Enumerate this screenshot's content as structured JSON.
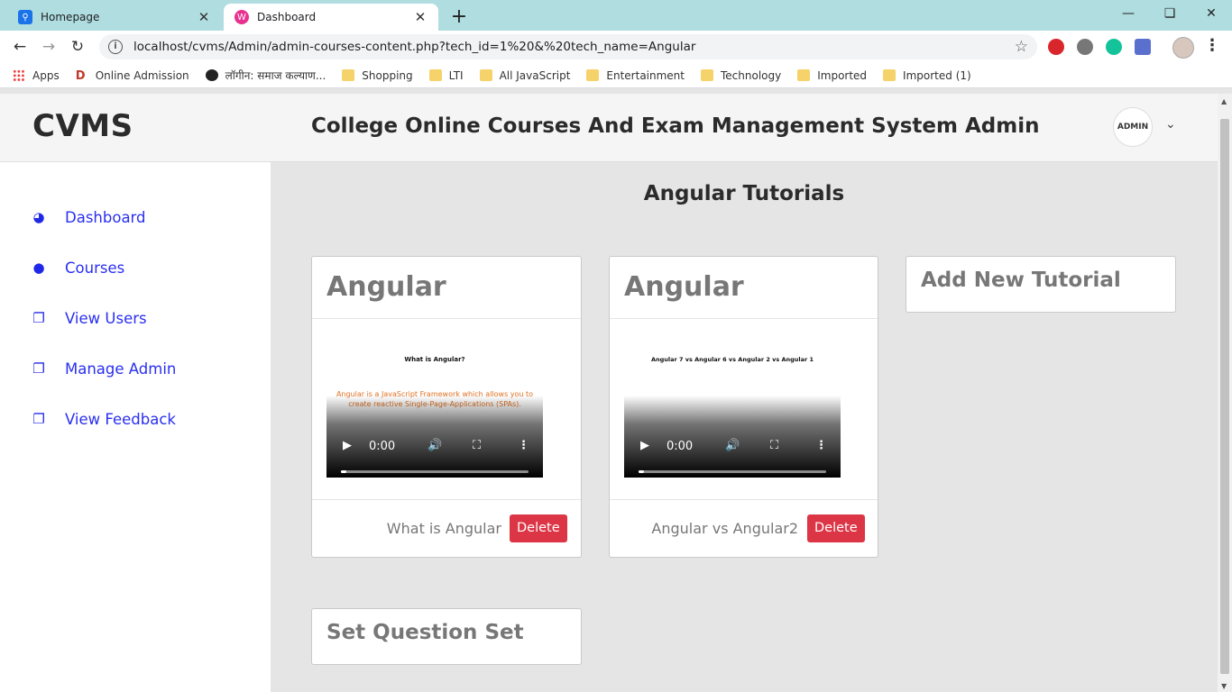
{
  "browser": {
    "tabs": [
      {
        "title": "Homepage"
      },
      {
        "title": "Dashboard"
      }
    ],
    "url": "localhost/cvms/Admin/admin-courses-content.php?tech_id=1%20&%20tech_name=Angular",
    "bookmarks": [
      {
        "label": "Apps"
      },
      {
        "label": "Online Admission"
      },
      {
        "label": "लॉगीन: समाज कल्याण..."
      },
      {
        "label": "Shopping"
      },
      {
        "label": "LTI"
      },
      {
        "label": "All JavaScript"
      },
      {
        "label": "Entertainment"
      },
      {
        "label": "Technology"
      },
      {
        "label": "Imported"
      },
      {
        "label": "Imported (1)"
      }
    ]
  },
  "sidebar": {
    "brand": "CVMS",
    "items": [
      {
        "label": "Dashboard",
        "icon": "tachometer-icon"
      },
      {
        "label": "Courses",
        "icon": "user-icon"
      },
      {
        "label": "View Users",
        "icon": "files-icon"
      },
      {
        "label": "Manage Admin",
        "icon": "files-icon"
      },
      {
        "label": "View Feedback",
        "icon": "files-icon"
      }
    ]
  },
  "header": {
    "title": "College Online Courses And Exam Management System Admin",
    "avatar_text": "ADMIN"
  },
  "main": {
    "page_title": "Angular Tutorials",
    "tutorials": [
      {
        "title": "Angular",
        "video_heading": "What is Angular?",
        "video_subtitle": "Angular is a JavaScript Framework which allows you to create reactive Single-Page-Applications (SPAs).",
        "time": "0:00",
        "progress": 0.02,
        "caption": "What is Angular",
        "delete_label": "Delete"
      },
      {
        "title": "Angular",
        "video_heading": "Angular 7 vs Angular 6 vs Angular 2 vs Angular 1",
        "video_subtitle": "",
        "time": "0:00",
        "progress": 0.02,
        "caption": "Angular vs Angular2",
        "delete_label": "Delete"
      }
    ],
    "add_tutorial_label": "Add New Tutorial",
    "question_set_label": "Set Question Set"
  },
  "colors": {
    "accent_link": "#2a2ff0",
    "danger": "#dc3545",
    "tabbar": "#afdde0"
  }
}
